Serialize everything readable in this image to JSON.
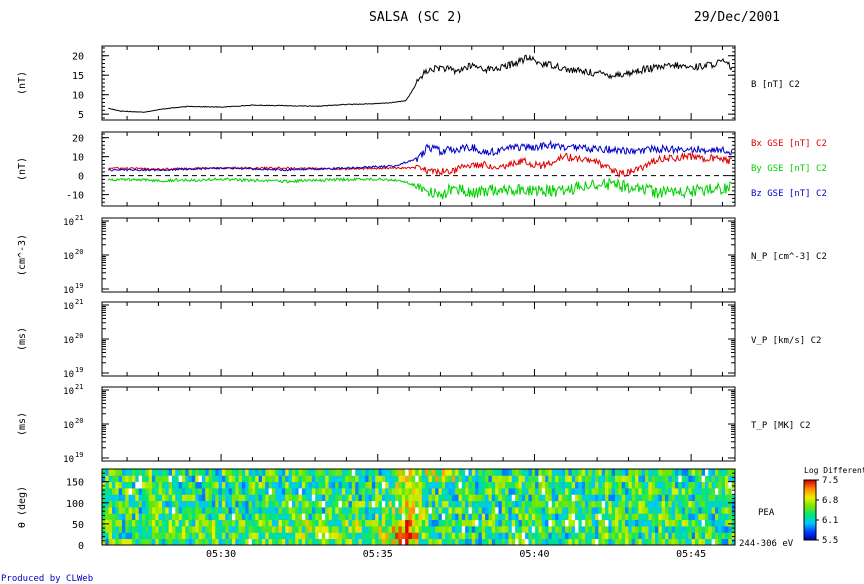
{
  "header": {
    "title": "SALSA (SC 2)",
    "date": "29/Dec/2001"
  },
  "footer": {
    "credit": "Produced by CLWeb"
  },
  "colors": {
    "bx": "#e00000",
    "by": "#00d000",
    "bz": "#0000c8",
    "b": "#000000"
  },
  "chart_data": [
    {
      "id": "b-total",
      "type": "line",
      "ylabel": "(nT)",
      "legend": [
        "B [nT] C2"
      ],
      "yticks": [
        5,
        10,
        15,
        20
      ],
      "ylim": [
        3.5,
        22.5
      ],
      "series": [
        {
          "name": "B [nT] C2",
          "x": [
            26.4,
            26.8,
            27.5,
            28.3,
            29,
            30,
            31,
            32,
            33,
            34,
            35,
            35.5,
            35.9,
            36.1,
            36.4,
            36.7,
            37,
            37.5,
            38,
            38.5,
            39,
            39.5,
            39.8,
            40.2,
            40.7,
            41,
            41.5,
            42,
            42.5,
            43,
            43.5,
            44,
            44.5,
            45,
            45.5,
            46,
            46.3
          ],
          "y": [
            6.5,
            5.8,
            5.5,
            6.5,
            7,
            6.8,
            7.3,
            7.2,
            7,
            7.5,
            7.7,
            8,
            8.5,
            11,
            15,
            16.5,
            17,
            16,
            17.5,
            16.5,
            17,
            18.5,
            19.5,
            18,
            17.5,
            16.5,
            16,
            15.5,
            15,
            15.5,
            16.5,
            17,
            17.5,
            17,
            17.5,
            18.5,
            17
          ]
        }
      ]
    },
    {
      "id": "b-components",
      "type": "line",
      "ylabel": "(nT)",
      "legend": [
        "Bx GSE [nT] C2",
        "By GSE [nT] C2",
        "Bz GSE [nT] C2"
      ],
      "yticks": [
        -10,
        0,
        10,
        20
      ],
      "ylim": [
        -16,
        23
      ],
      "zero_line": true,
      "series": [
        {
          "name": "Bx GSE [nT] C2",
          "x": [
            26.4,
            28,
            30,
            32,
            34,
            35.5,
            36.3,
            36.8,
            37.5,
            38,
            39,
            39.6,
            40.2,
            41,
            42,
            42.5,
            42.9,
            43.4,
            44,
            45,
            46.3
          ],
          "y": [
            4,
            3.5,
            4,
            4,
            3.5,
            4,
            4,
            2,
            3,
            6,
            5,
            8,
            5,
            10,
            7,
            2,
            1,
            4,
            9,
            10,
            8
          ]
        },
        {
          "name": "By GSE [nT] C2",
          "x": [
            26.4,
            28,
            30,
            32,
            34,
            35.5,
            36.2,
            36.5,
            37,
            37.5,
            38,
            39,
            40,
            41,
            42,
            43,
            44,
            45,
            46.3
          ],
          "y": [
            -2,
            -2.5,
            -2,
            -3,
            -2,
            -2,
            -5,
            -8,
            -10,
            -6,
            -9,
            -7,
            -8,
            -8,
            -4,
            -6,
            -9,
            -8,
            -6
          ]
        },
        {
          "name": "Bz GSE [nT] C2",
          "x": [
            26.4,
            28,
            30,
            32,
            34,
            35.5,
            36.3,
            36.6,
            37,
            38,
            38.5,
            39,
            39.8,
            40.5,
            41,
            42,
            43,
            44,
            45,
            46.3
          ],
          "y": [
            3,
            3,
            4,
            3,
            4,
            5,
            9,
            15,
            13,
            15,
            12,
            14,
            15,
            16,
            15,
            14,
            13,
            14,
            14,
            13
          ]
        }
      ]
    },
    {
      "id": "np",
      "type": "line",
      "ylabel": "(cm^-3)",
      "legend": [
        "N_P [cm^-3] C2"
      ],
      "ytick_labels": [
        "10",
        "10",
        "10"
      ],
      "ytick_exponents": [
        "21",
        "20",
        "19"
      ],
      "series": []
    },
    {
      "id": "vp",
      "type": "line",
      "ylabel": "(ms)",
      "legend": [
        "V_P [km/s] C2"
      ],
      "ytick_labels": [
        "10",
        "10",
        "10"
      ],
      "ytick_exponents": [
        "21",
        "20",
        "19"
      ],
      "series": []
    },
    {
      "id": "tp",
      "type": "line",
      "ylabel": "(ms)",
      "legend": [
        "T_P [MK] C2"
      ],
      "ytick_labels": [
        "10",
        "10",
        "10"
      ],
      "ytick_exponents": [
        "21",
        "20",
        "19"
      ],
      "series": []
    },
    {
      "id": "pea",
      "type": "heatmap",
      "ylabel": "θ (deg)",
      "yticks": [
        0,
        50,
        100,
        150
      ],
      "ylim": [
        0,
        180
      ],
      "legend": [
        "PEA",
        "244-306 eV"
      ],
      "colorbar": {
        "title": "Log Differenti",
        "ticks": [
          "7.5",
          "6.8",
          "6.1",
          "5.5"
        ],
        "range": [
          5.5,
          7.5
        ]
      }
    }
  ],
  "x_axis": {
    "ticks": [
      "05:30",
      "05:35",
      "05:40",
      "05:45"
    ],
    "tick_minutes": [
      30,
      35,
      40,
      45
    ],
    "range_minutes": [
      26.2,
      46.4
    ]
  }
}
